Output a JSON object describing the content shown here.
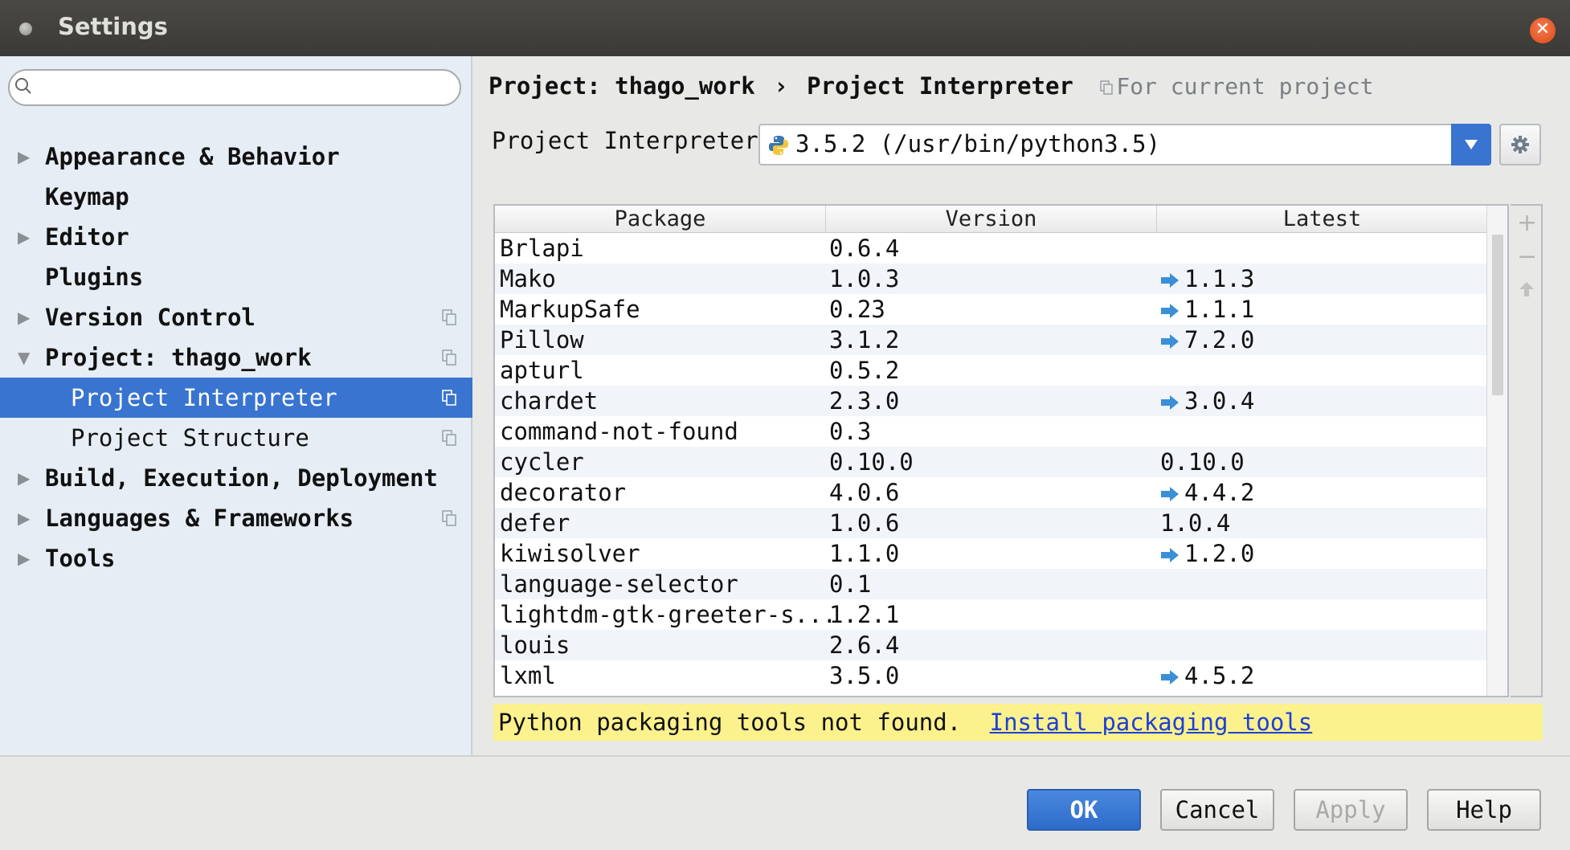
{
  "window": {
    "title": "Settings"
  },
  "sidebar": {
    "search_placeholder": "",
    "items": [
      {
        "label": "Appearance & Behavior",
        "expandable": true,
        "expanded": false,
        "copy_icon": false
      },
      {
        "label": "Keymap",
        "expandable": false,
        "copy_icon": false
      },
      {
        "label": "Editor",
        "expandable": true,
        "expanded": false,
        "copy_icon": false
      },
      {
        "label": "Plugins",
        "expandable": false,
        "copy_icon": false
      },
      {
        "label": "Version Control",
        "expandable": true,
        "expanded": false,
        "copy_icon": true
      },
      {
        "label": "Project: thago_work",
        "expandable": true,
        "expanded": true,
        "copy_icon": true
      },
      {
        "label": "Project Interpreter",
        "sub": true,
        "selected": true,
        "copy_icon": true
      },
      {
        "label": "Project Structure",
        "sub": true,
        "selected": false,
        "copy_icon": true
      },
      {
        "label": "Build, Execution, Deployment",
        "expandable": true,
        "expanded": false,
        "copy_icon": false
      },
      {
        "label": "Languages & Frameworks",
        "expandable": true,
        "expanded": false,
        "copy_icon": true
      },
      {
        "label": "Tools",
        "expandable": true,
        "expanded": false,
        "copy_icon": false
      }
    ]
  },
  "breadcrumb": {
    "project": "Project: thago_work",
    "separator": "›",
    "page": "Project Interpreter",
    "scope": "For current project"
  },
  "interpreter": {
    "label": "Project Interpreter:",
    "value": "3.5.2 (/usr/bin/python3.5)"
  },
  "packages": {
    "columns": [
      "Package",
      "Version",
      "Latest"
    ],
    "rows": [
      {
        "package": "Brlapi",
        "version": "0.6.4",
        "latest": "",
        "upgrade": false
      },
      {
        "package": "Mako",
        "version": "1.0.3",
        "latest": "1.1.3",
        "upgrade": true
      },
      {
        "package": "MarkupSafe",
        "version": "0.23",
        "latest": "1.1.1",
        "upgrade": true
      },
      {
        "package": "Pillow",
        "version": "3.1.2",
        "latest": "7.2.0",
        "upgrade": true
      },
      {
        "package": "apturl",
        "version": "0.5.2",
        "latest": "",
        "upgrade": false
      },
      {
        "package": "chardet",
        "version": "2.3.0",
        "latest": "3.0.4",
        "upgrade": true
      },
      {
        "package": "command-not-found",
        "version": "0.3",
        "latest": "",
        "upgrade": false
      },
      {
        "package": "cycler",
        "version": "0.10.0",
        "latest": "0.10.0",
        "upgrade": false
      },
      {
        "package": "decorator",
        "version": "4.0.6",
        "latest": "4.4.2",
        "upgrade": true
      },
      {
        "package": "defer",
        "version": "1.0.6",
        "latest": "1.0.4",
        "upgrade": false
      },
      {
        "package": "kiwisolver",
        "version": "1.1.0",
        "latest": "1.2.0",
        "upgrade": true
      },
      {
        "package": "language-selector",
        "version": "0.1",
        "latest": "",
        "upgrade": false
      },
      {
        "package": "lightdm-gtk-greeter-s...",
        "version": "1.2.1",
        "latest": "",
        "upgrade": false
      },
      {
        "package": "louis",
        "version": "2.6.4",
        "latest": "",
        "upgrade": false
      },
      {
        "package": "lxml",
        "version": "3.5.0",
        "latest": "4.5.2",
        "upgrade": true
      }
    ]
  },
  "warning": {
    "text": "Python packaging tools not found.",
    "link": "Install packaging tools"
  },
  "buttons": {
    "ok": "OK",
    "cancel": "Cancel",
    "apply": "Apply",
    "help": "Help"
  },
  "colors": {
    "selection": "#3874d0",
    "upgrade_arrow": "#3a8fd6",
    "warning_bg": "#fbf18d",
    "link": "#1d40d8"
  },
  "icons": {
    "search": "search-icon",
    "copy": "copy-icon",
    "python": "python-icon",
    "gear": "gear-icon",
    "add": "plus-icon",
    "remove": "minus-icon",
    "upgrade": "arrow-up-icon",
    "close": "close-icon"
  }
}
